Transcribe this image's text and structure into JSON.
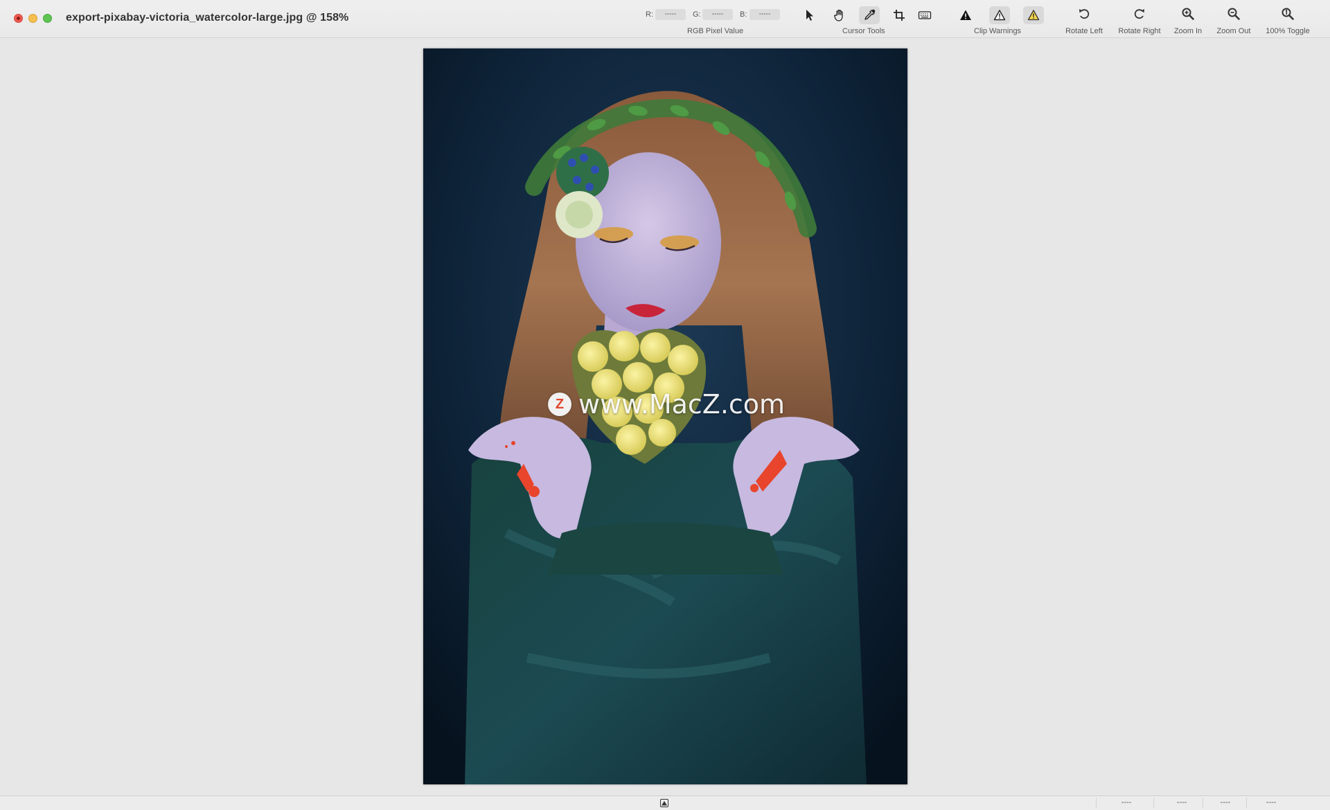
{
  "window": {
    "title": "export-pixabay-victoria_watercolor-large.jpg @ 158%"
  },
  "rgb": {
    "r_label": "R:",
    "g_label": "G:",
    "b_label": "B:",
    "r_value": "-----",
    "g_value": "-----",
    "b_value": "-----",
    "caption": "RGB Pixel Value"
  },
  "cursor_tools": {
    "caption": "Cursor Tools",
    "tools": [
      "arrow-pointer-icon",
      "hand-icon",
      "eyedropper-icon",
      "crop-icon",
      "keyboard-icon"
    ],
    "active": "eyedropper-icon"
  },
  "clip_warnings": {
    "caption": "Clip Warnings",
    "icons": [
      "warning-filled-icon",
      "warning-outline-icon",
      "warning-yellow-icon"
    ]
  },
  "buttons": {
    "rotate_left": "Rotate Left",
    "rotate_right": "Rotate Right",
    "zoom_in": "Zoom In",
    "zoom_out": "Zoom Out",
    "toggle_100": "100% Toggle"
  },
  "image": {
    "watermark_logo": "Z",
    "watermark_text": "www.MacZ.com"
  },
  "status": {
    "cells": [
      "----",
      "----",
      "----",
      "----"
    ]
  },
  "colors": {
    "close": "#ee5a52",
    "minimize": "#f5bf4f",
    "maximize": "#5fc454",
    "clip_highlight": "#e8452c"
  }
}
